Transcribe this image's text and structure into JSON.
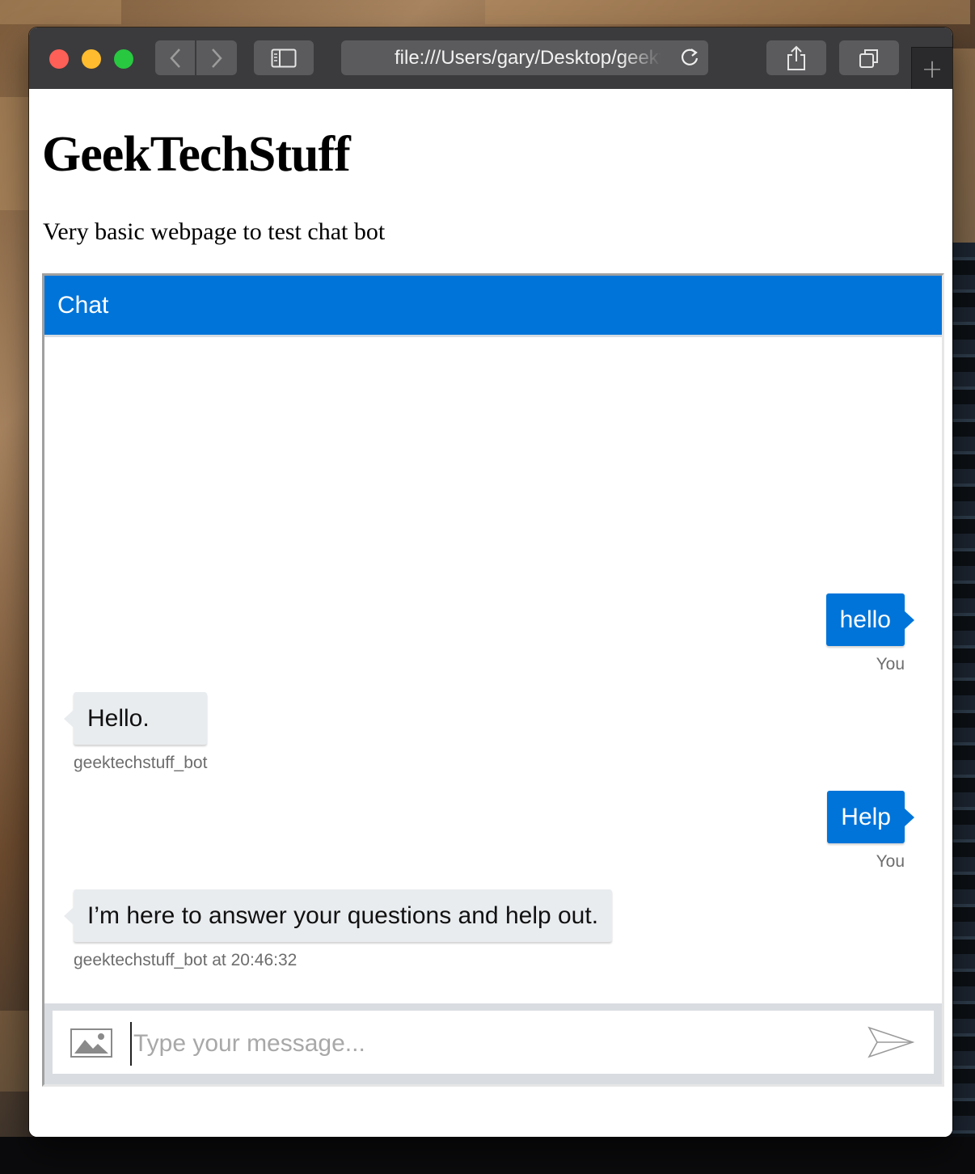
{
  "browser": {
    "url": "file:///Users/gary/Desktop/geektechstuff.html",
    "new_tab_label": "+"
  },
  "page": {
    "title": "GeekTechStuff",
    "description": "Very basic webpage to test chat bot"
  },
  "chat": {
    "header": "Chat",
    "messages": [
      {
        "from": "user",
        "text": "hello",
        "meta": "You"
      },
      {
        "from": "bot",
        "text": "Hello.",
        "meta": "geektechstuff_bot"
      },
      {
        "from": "user",
        "text": "Help",
        "meta": "You"
      },
      {
        "from": "bot",
        "text": "I’m here to answer your questions and help out.",
        "meta": "geektechstuff_bot at 20:46:32"
      }
    ],
    "input_placeholder": "Type your message..."
  },
  "colors": {
    "accent": "#0074d9",
    "bot_bubble": "#e9ecef",
    "toolbar": "#3b3b3d"
  },
  "icons": [
    "back-icon",
    "forward-icon",
    "sidebar-icon",
    "reload-icon",
    "share-icon",
    "tabs-icon",
    "image-icon",
    "send-icon"
  ]
}
